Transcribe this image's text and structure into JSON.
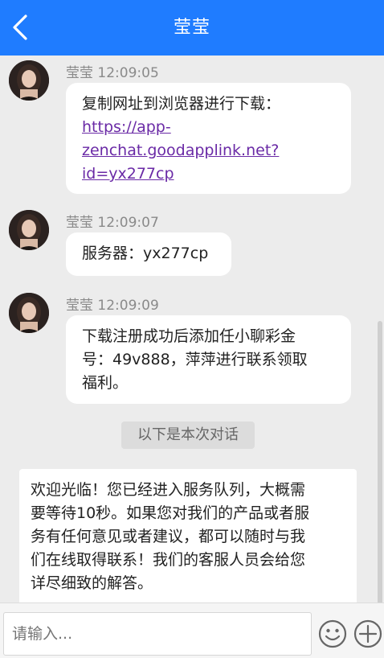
{
  "header": {
    "title": "莹莹"
  },
  "messages": [
    {
      "sender": "莹莹",
      "time": "12:09:05",
      "text": "复制网址到浏览器进行下载：",
      "link": "https://app-zenchat.goodapplink.net?id=yx277cp",
      "link_lines": [
        "https://app-",
        "zenchat.goodapplink.net?",
        "id=yx277cp"
      ]
    },
    {
      "sender": "莹莹",
      "time": "12:09:07",
      "text": "服务器：yx277cp"
    },
    {
      "sender": "莹莹",
      "time": "12:09:09",
      "lines": [
        "下载注册成功后添加任小聊彩金",
        "号：49v888，萍萍进行联系领取",
        "福利。"
      ]
    }
  ],
  "divider": "以下是本次对话",
  "welcome": {
    "lines": [
      "欢迎光临！您已经进入服务队列，大概需",
      "要等待10秒。如果您对我们的产品或者服",
      "务有任何意见或者建议，都可以随时与我",
      "们在线取得联系！我们的客服人员会给您",
      "详尽细致的解答。"
    ]
  },
  "input": {
    "placeholder": "请输入..."
  },
  "icons": {
    "back": "chevron-left-icon",
    "emoji": "smiley-icon",
    "add": "plus-circle-icon"
  },
  "colors": {
    "header": "#1f7cff",
    "link": "#6a2aa6",
    "background": "#ececec"
  }
}
